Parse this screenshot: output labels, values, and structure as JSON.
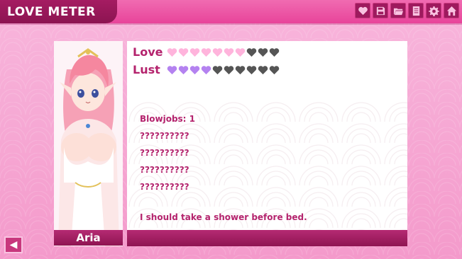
{
  "header": {
    "title": "LOVE METER"
  },
  "toolbar": {
    "icons": [
      "heart-icon",
      "save-icon",
      "folder-open-icon",
      "notes-icon",
      "gear-icon",
      "home-icon"
    ]
  },
  "character": {
    "name": "Aria"
  },
  "meters": {
    "love": {
      "label": "Love",
      "filled": 7,
      "total": 10,
      "fill_color": "#ffb4dc",
      "empty_color": "#555555"
    },
    "lust": {
      "label": "Lust",
      "filled": 4,
      "total": 10,
      "fill_color": "#b482f0",
      "empty_color": "#555555"
    }
  },
  "stats": [
    "Blowjobs: 1",
    "??????????",
    "??????????",
    "??????????",
    "??????????"
  ],
  "remark": "I should take a shower before bed.",
  "colors": {
    "accent": "#e8449a",
    "dark": "#8f1552",
    "text": "#b4236d"
  }
}
